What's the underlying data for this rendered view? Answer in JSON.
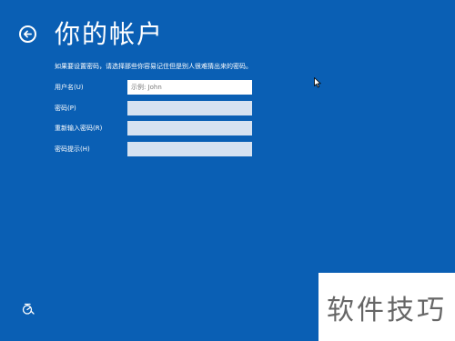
{
  "header": {
    "back_icon": "back-arrow-icon",
    "title": "你的帐户"
  },
  "instruction": "如果要设置密码，请选择那些你容易记住但是别人很难猜出来的密码。",
  "form": {
    "username": {
      "label": "用户名(U)",
      "value": "",
      "placeholder": "示例: John"
    },
    "password": {
      "label": "密码(P)",
      "value": "",
      "placeholder": ""
    },
    "password_confirm": {
      "label": "重新输入密码(R)",
      "value": "",
      "placeholder": ""
    },
    "password_hint": {
      "label": "密码提示(H)",
      "value": "",
      "placeholder": ""
    }
  },
  "footer": {
    "accessibility_icon": "ease-of-access-icon"
  },
  "watermark": "软件技巧",
  "colors": {
    "background": "#0a5fb4",
    "field_active": "#ffffff",
    "field_inactive": "#d6e2f1"
  }
}
